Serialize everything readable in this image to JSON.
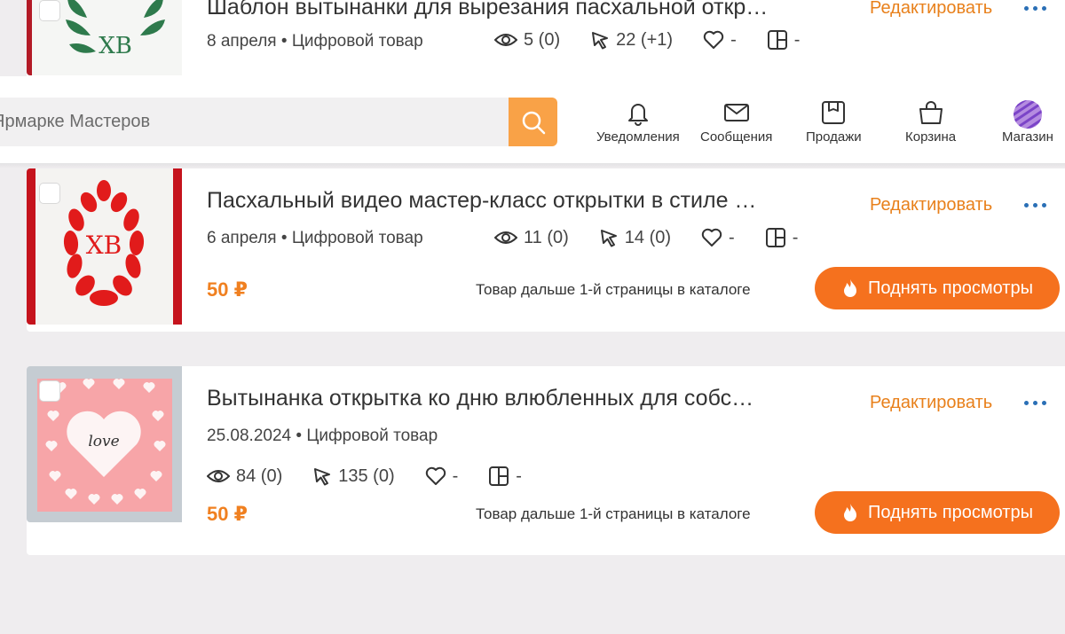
{
  "header": {
    "search_placeholder": "Ярмарке Мастеров",
    "nav": [
      {
        "label": "Уведомления",
        "icon": "bell-icon"
      },
      {
        "label": "Сообщения",
        "icon": "envelope-icon"
      },
      {
        "label": "Продажи",
        "icon": "box-icon"
      },
      {
        "label": "Корзина",
        "icon": "basket-icon"
      },
      {
        "label": "Магазин",
        "icon": "shop-avatar-icon"
      }
    ]
  },
  "products": [
    {
      "title": "Шаблон вытынанки для вырезания пасхальной откр…",
      "date": "8 апреля",
      "type": "Цифровой товар",
      "views": "5 (0)",
      "clicks": "22 (+1)",
      "likes": "-",
      "collections": "-",
      "edit_label": "Редактировать"
    },
    {
      "title": "Пасхальный видео мастер-класс открытки в стиле …",
      "date": "6 апреля",
      "type": "Цифровой товар",
      "views": "11 (0)",
      "clicks": "14 (0)",
      "likes": "-",
      "collections": "-",
      "edit_label": "Редактировать",
      "price": "50 ₽",
      "catalog_note": "Товар дальше 1-й страницы в каталоге",
      "boost_label": "Поднять просмотры"
    },
    {
      "title": "Вытынанка открытка ко дню влюбленных для собс…",
      "date": "25.08.2024",
      "type": "Цифровой товар",
      "views": "84 (0)",
      "clicks": "135 (0)",
      "likes": "-",
      "collections": "-",
      "edit_label": "Редактировать",
      "price": "50 ₽",
      "catalog_note": "Товар дальше 1-й страницы в каталоге",
      "boost_label": "Поднять просмотры",
      "image_text": "love"
    }
  ],
  "meta_separator": "•",
  "colors": {
    "accent": "#f5711e",
    "edit_link": "#e8801b",
    "search_button": "#f9a247",
    "dots": "#2a6fb6"
  }
}
